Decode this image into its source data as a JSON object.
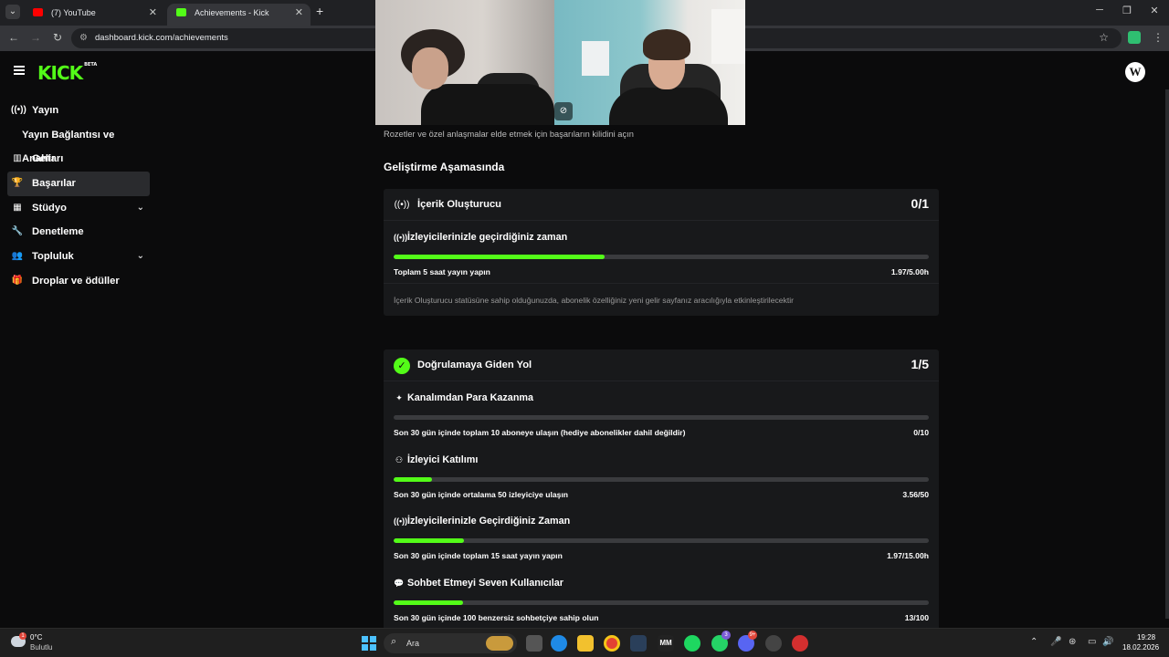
{
  "browser": {
    "tabs": [
      {
        "title": "(7) YouTube",
        "favicon_color": "#ff0000"
      },
      {
        "title": "Achievements - Kick Dashboard",
        "favicon_color": "#53fc18"
      }
    ],
    "url": "dashboard.kick.com/achievements"
  },
  "header": {
    "logo_text": "KICK",
    "logo_badge": "BETA",
    "avatar_letter": "W"
  },
  "sidebar": {
    "items": [
      {
        "label": "Yayın",
        "icon": "broadcast-icon"
      },
      {
        "label": "Yayın Bağlantısı ve Anahtarı",
        "icon": ""
      },
      {
        "label": "Gelir",
        "icon": "chart-icon"
      },
      {
        "label": "Başarılar",
        "icon": "trophy-icon",
        "active": true
      },
      {
        "label": "Stüdyo",
        "icon": "studio-icon",
        "expandable": true
      },
      {
        "label": "Denetleme",
        "icon": "wrench-icon"
      },
      {
        "label": "Topluluk",
        "icon": "users-icon",
        "expandable": true
      },
      {
        "label": "Droplar ve ödüller",
        "icon": "gift-icon"
      }
    ]
  },
  "main": {
    "subtitle": "Rozetler ve özel anlaşmalar elde etmek için başarıların kilidini açın",
    "section_title": "Geliştirme Aşamasında",
    "cards": [
      {
        "title": "İçerik Oluşturucu",
        "icon": "broadcast-icon",
        "count": "0/1",
        "goals": [
          {
            "name": "İzleyicilerinizle geçirdiğiniz zaman",
            "icon": "broadcast-icon",
            "desc": "Toplam 5 saat yayın yapın",
            "value": "1.97/5.00h",
            "progress": 0.394
          }
        ],
        "note": "İçerik Oluşturucu statüsüne sahip olduğunuzda, abonelik özelliğiniz yeni gelir sayfanız aracılığıyla etkinleştirilecektir"
      },
      {
        "title": "Doğrulamaya Giden Yol",
        "icon": "verified-badge-icon",
        "count": "1/5",
        "goals": [
          {
            "name": "Kanalımdan Para Kazanma",
            "icon": "sparkle-icon",
            "desc": "Son 30 gün içinde toplam 10 aboneye ulaşın (hediye abonelikler dahil değildir)",
            "value": "0/10",
            "progress": 0.0
          },
          {
            "name": "İzleyici Katılımı",
            "icon": "viewers-icon",
            "desc": "Son 30 gün içinde ortalama 50 izleyiciye ulaşın",
            "value": "3.56/50",
            "progress": 0.0712
          },
          {
            "name": "İzleyicilerinizle Geçirdiğiniz Zaman",
            "icon": "broadcast-icon",
            "desc": "Son 30 gün içinde toplam 15 saat yayın yapın",
            "value": "1.97/15.00h",
            "progress": 0.1313
          },
          {
            "name": "Sohbet Etmeyi Seven Kullanıcılar",
            "icon": "chat-icon",
            "desc": "Son 30 gün içinde 100 benzersiz sohbetçiye sahip olun",
            "value": "13/100",
            "progress": 0.13
          }
        ]
      }
    ]
  },
  "taskbar": {
    "weather_temp": "0°C",
    "weather_desc": "Bulutlu",
    "weather_badge": "1",
    "search_label": "Ara",
    "time": "19:28",
    "date": "18.02.2026",
    "badges": [
      "3",
      "9+"
    ]
  }
}
